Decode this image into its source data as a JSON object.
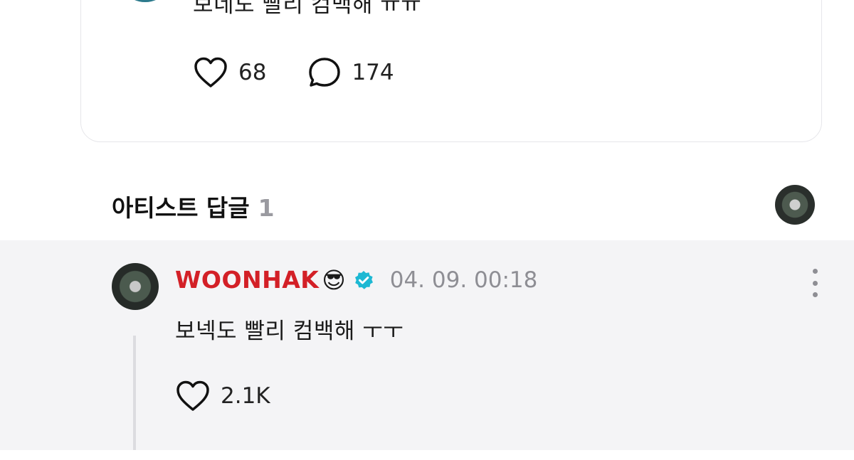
{
  "post": {
    "text": "보네도 빨리 컴백해 ㅠㅠ",
    "likes": "68",
    "comments": "174",
    "icons": {
      "like": "heart-icon",
      "comment": "comment-bubble-icon"
    }
  },
  "artist_replies": {
    "title": "아티스트 답글",
    "count": "1"
  },
  "reply": {
    "author": "WOONHAK",
    "emoji": "😎",
    "timestamp": "04. 09. 00:18",
    "text": "보넥도 빨리 컴백해 ㅜㅜ",
    "likes": "2.1K",
    "icons": {
      "verified": "verified-badge-icon",
      "more": "more-vertical-icon",
      "like": "heart-icon"
    }
  },
  "colors": {
    "author_name": "#d32027",
    "verified": "#1db8d3",
    "reply_background": "#f4f4f6",
    "muted_text": "#8e8e94"
  }
}
